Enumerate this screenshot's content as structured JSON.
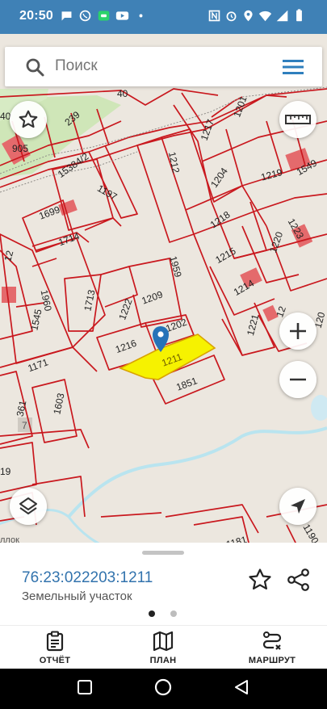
{
  "status_bar": {
    "time": "20:50",
    "left_icons": [
      "chat-icon",
      "whatsapp-icon",
      "messages-icon",
      "youtube-icon",
      "more-dot-icon"
    ],
    "right_icons": [
      "nfc-icon",
      "alarm-icon",
      "location-icon",
      "wifi-icon",
      "signal-icon",
      "battery-icon"
    ]
  },
  "search": {
    "placeholder": "Поиск",
    "search_icon": "search-icon",
    "menu_icon": "menu-icon"
  },
  "map": {
    "parcel_labels": [
      "40",
      "239",
      "905",
      "15384/2",
      "1197",
      "1212",
      "1217",
      "1201",
      "1204",
      "1219",
      "1549",
      "1699",
      "1714",
      "1218",
      "1223",
      "1959",
      "1215",
      "1220",
      "1713",
      "1222",
      "1209",
      "1214",
      "1960",
      "1545",
      "1216",
      "1202",
      "1211",
      "1221",
      "1171",
      "1851",
      "1603",
      "361",
      "7",
      "19",
      "1181",
      "1190",
      "ллок"
    ],
    "highlighted_parcel": "1211",
    "accent_color": "#c9181e",
    "highlight_color": "#f6f200",
    "marker_color": "#2673b8"
  },
  "controls": {
    "favorite_icon": "star-outline-icon",
    "ruler_icon": "ruler-icon",
    "zoom_in_icon": "plus-icon",
    "zoom_out_icon": "minus-icon",
    "layers_icon": "layers-icon",
    "locate_icon": "navigation-arrow-icon"
  },
  "sheet": {
    "cadastral_number": "76:23:022203:1211",
    "parcel_type": "Земельный участок",
    "pager": [
      true,
      false
    ]
  },
  "bottom_nav": {
    "report_label": "ОТЧЁТ",
    "plan_label": "ПЛАН",
    "route_label": "МАРШРУТ"
  }
}
